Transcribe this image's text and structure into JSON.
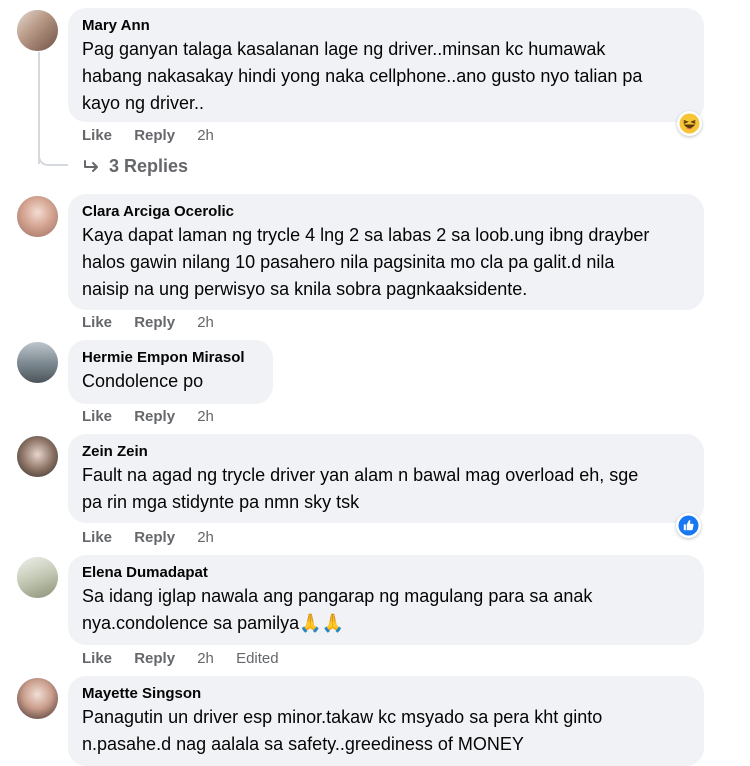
{
  "comments": [
    {
      "name": "Mary Ann",
      "lines": [
        "Pag ganyan talaga kasalanan lage ng driver..minsan kc humawak",
        "habang nakasakay hindi yong naka cellphone..ano gusto nyo talian pa",
        "kayo ng driver.."
      ],
      "like": "Like",
      "reply": "Reply",
      "time": "2h",
      "reaction": "haha-icon",
      "replies_label": "3 Replies"
    },
    {
      "name": "Clara Arciga Ocerolic",
      "lines": [
        "Kaya dapat laman ng trycle 4 lng 2 sa labas 2 sa loob.ung ibng drayber",
        "halos gawin nilang 10 pasahero nila pagsinita mo cla pa galit.d nila",
        "naisip na ung perwisyo sa knila sobra pagnkaaksidente."
      ],
      "like": "Like",
      "reply": "Reply",
      "time": "2h"
    },
    {
      "name": "Hermie Empon Mirasol",
      "lines": [
        "Condolence po"
      ],
      "like": "Like",
      "reply": "Reply",
      "time": "2h"
    },
    {
      "name": "Zein Zein",
      "lines": [
        "Fault na agad ng trycle driver yan alam n bawal mag overload eh, sge",
        "pa rin mga stidynte pa nmn sky tsk"
      ],
      "like": "Like",
      "reply": "Reply",
      "time": "2h",
      "reaction": "like-icon"
    },
    {
      "name": "Elena Dumadapat",
      "lines": [
        "Sa idang iglap nawala ang pangarap ng magulang para sa anak",
        "nya.condolence sa pamilya🙏🙏"
      ],
      "like": "Like",
      "reply": "Reply",
      "time": "2h",
      "edited": "Edited"
    },
    {
      "name": "Mayette Singson",
      "lines": [
        "Panagutin un driver esp minor.takaw kc msyado sa pera kht ginto",
        "n.pasahe.d nag aalala sa safety..greediness of MONEY"
      ]
    }
  ],
  "colors": {
    "bubble": "#f0f2f5",
    "meta": "#65676b",
    "like_blue": "#1877f2"
  }
}
